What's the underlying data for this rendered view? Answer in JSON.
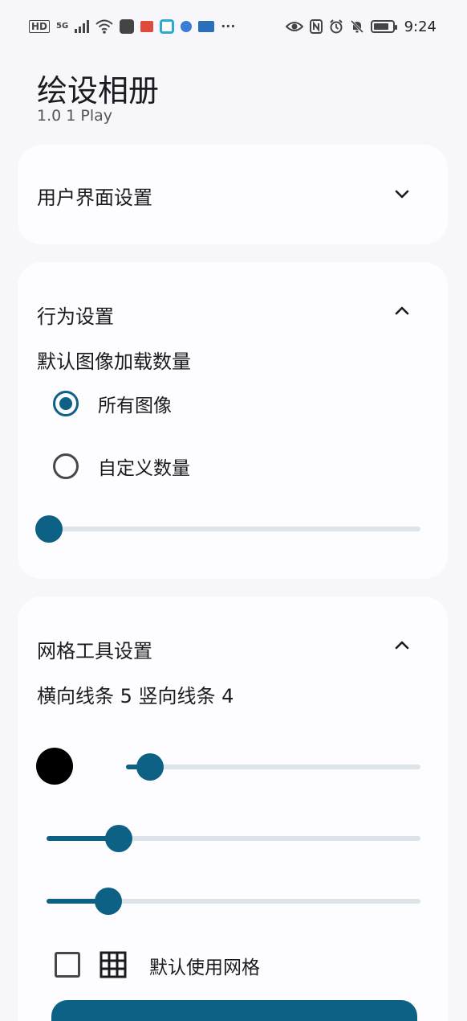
{
  "status_bar": {
    "left_icons": [
      "HD",
      "5G",
      "signal-icon",
      "wifi-icon",
      "app-icon",
      "app-icon",
      "app-icon",
      "app-icon",
      "app-icon",
      "more-icon"
    ],
    "hd_label": "HD",
    "net_label": "5G",
    "more_label": "···",
    "time": "9:24"
  },
  "header": {
    "title": "绘设相册",
    "version": "1.0 1 Play"
  },
  "sections": {
    "ui_settings": {
      "title": "用户界面设置",
      "expanded": false
    },
    "behavior_settings": {
      "title": "行为设置",
      "expanded": true,
      "default_load_label": "默认图像加载数量",
      "options": [
        {
          "label": "所有图像",
          "selected": true
        },
        {
          "label": "自定义数量",
          "selected": false
        }
      ],
      "slider_value": 0
    },
    "grid_tool_settings": {
      "title": "网格工具设置",
      "expanded": true,
      "lines_label": "横向线条 5 竖向线条 4",
      "color": "#000000",
      "slider1_value": 0.04,
      "slider2_value": 0.17,
      "slider3_value": 0.14,
      "default_grid_label": "默认使用网格",
      "default_grid_checked": false
    }
  },
  "accent_color": "#0d6184"
}
